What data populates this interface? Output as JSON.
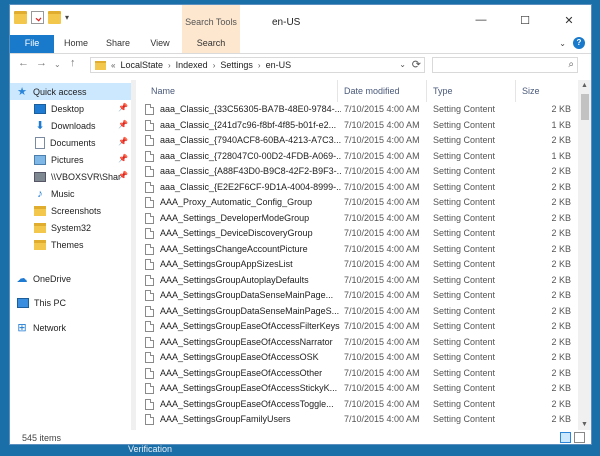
{
  "window": {
    "title": "en-US",
    "context_tab": "Search Tools",
    "controls": {
      "minimize": "—",
      "maximize": "☐",
      "close": "✕"
    }
  },
  "ribbon": {
    "tabs": [
      "File",
      "Home",
      "Share",
      "View",
      "Search"
    ],
    "collapse_icon": "chevron-down-icon",
    "help_label": "?"
  },
  "address": {
    "prefix": "«",
    "crumbs": [
      "LocalState",
      "Indexed",
      "Settings",
      "en-US"
    ],
    "search_placeholder": ""
  },
  "nav_pane": {
    "items": [
      {
        "label": "Quick access",
        "icon": "star-icon",
        "pinned": false
      },
      {
        "label": "Desktop",
        "icon": "desktop-icon",
        "pinned": true
      },
      {
        "label": "Downloads",
        "icon": "downloads-icon",
        "pinned": true
      },
      {
        "label": "Documents",
        "icon": "documents-icon",
        "pinned": true
      },
      {
        "label": "Pictures",
        "icon": "pictures-icon",
        "pinned": true
      },
      {
        "label": "\\\\VBOXSVR\\Shar",
        "icon": "network-drive-icon",
        "pinned": true
      },
      {
        "label": "Music",
        "icon": "music-icon",
        "pinned": false
      },
      {
        "label": "Screenshots",
        "icon": "folder-icon",
        "pinned": false
      },
      {
        "label": "System32",
        "icon": "folder-icon",
        "pinned": false
      },
      {
        "label": "Themes",
        "icon": "folder-icon",
        "pinned": false
      },
      {
        "label": "OneDrive",
        "icon": "onedrive-icon",
        "pinned": false
      },
      {
        "label": "This PC",
        "icon": "this-pc-icon",
        "pinned": false
      },
      {
        "label": "Network",
        "icon": "network-icon",
        "pinned": false
      }
    ]
  },
  "columns": [
    "Name",
    "Date modified",
    "Type",
    "Size"
  ],
  "files": [
    {
      "name": "aaa_Classic_{33C56305-BA7B-48E0-9784-...",
      "date": "7/10/2015 4:00 AM",
      "type": "Setting Content",
      "size": "2 KB"
    },
    {
      "name": "aaa_Classic_{241d7c96-f8bf-4f85-b01f-e2...",
      "date": "7/10/2015 4:00 AM",
      "type": "Setting Content",
      "size": "1 KB"
    },
    {
      "name": "aaa_Classic_{7940ACF8-60BA-4213-A7C3...",
      "date": "7/10/2015 4:00 AM",
      "type": "Setting Content",
      "size": "2 KB"
    },
    {
      "name": "aaa_Classic_{728047C0-00D2-4FDB-A069-...",
      "date": "7/10/2015 4:00 AM",
      "type": "Setting Content",
      "size": "1 KB"
    },
    {
      "name": "aaa_Classic_{A88F43D0-B9C8-42F2-B9F3-...",
      "date": "7/10/2015 4:00 AM",
      "type": "Setting Content",
      "size": "2 KB"
    },
    {
      "name": "aaa_Classic_{E2E2F6CF-9D1A-4004-8999-...",
      "date": "7/10/2015 4:00 AM",
      "type": "Setting Content",
      "size": "2 KB"
    },
    {
      "name": "AAA_Proxy_Automatic_Config_Group",
      "date": "7/10/2015 4:00 AM",
      "type": "Setting Content",
      "size": "2 KB"
    },
    {
      "name": "AAA_Settings_DeveloperModeGroup",
      "date": "7/10/2015 4:00 AM",
      "type": "Setting Content",
      "size": "2 KB"
    },
    {
      "name": "AAA_Settings_DeviceDiscoveryGroup",
      "date": "7/10/2015 4:00 AM",
      "type": "Setting Content",
      "size": "2 KB"
    },
    {
      "name": "AAA_SettingsChangeAccountPicture",
      "date": "7/10/2015 4:00 AM",
      "type": "Setting Content",
      "size": "2 KB"
    },
    {
      "name": "AAA_SettingsGroupAppSizesList",
      "date": "7/10/2015 4:00 AM",
      "type": "Setting Content",
      "size": "2 KB"
    },
    {
      "name": "AAA_SettingsGroupAutoplayDefaults",
      "date": "7/10/2015 4:00 AM",
      "type": "Setting Content",
      "size": "2 KB"
    },
    {
      "name": "AAA_SettingsGroupDataSenseMainPage...",
      "date": "7/10/2015 4:00 AM",
      "type": "Setting Content",
      "size": "2 KB"
    },
    {
      "name": "AAA_SettingsGroupDataSenseMainPageS...",
      "date": "7/10/2015 4:00 AM",
      "type": "Setting Content",
      "size": "2 KB"
    },
    {
      "name": "AAA_SettingsGroupEaseOfAccessFilterKeys",
      "date": "7/10/2015 4:00 AM",
      "type": "Setting Content",
      "size": "2 KB"
    },
    {
      "name": "AAA_SettingsGroupEaseOfAccessNarrator",
      "date": "7/10/2015 4:00 AM",
      "type": "Setting Content",
      "size": "2 KB"
    },
    {
      "name": "AAA_SettingsGroupEaseOfAccessOSK",
      "date": "7/10/2015 4:00 AM",
      "type": "Setting Content",
      "size": "2 KB"
    },
    {
      "name": "AAA_SettingsGroupEaseOfAccessOther",
      "date": "7/10/2015 4:00 AM",
      "type": "Setting Content",
      "size": "2 KB"
    },
    {
      "name": "AAA_SettingsGroupEaseOfAccessStickyK...",
      "date": "7/10/2015 4:00 AM",
      "type": "Setting Content",
      "size": "2 KB"
    },
    {
      "name": "AAA_SettingsGroupEaseOfAccessToggle...",
      "date": "7/10/2015 4:00 AM",
      "type": "Setting Content",
      "size": "2 KB"
    },
    {
      "name": "AAA_SettingsGroupFamilyUsers",
      "date": "7/10/2015 4:00 AM",
      "type": "Setting Content",
      "size": "2 KB"
    }
  ],
  "status": {
    "item_count": "545 items"
  },
  "desktop": {
    "behind_text": "Verification"
  },
  "colors": {
    "accent": "#1979ca",
    "selection": "#cce8ff",
    "context_tab": "#fde7cf"
  }
}
